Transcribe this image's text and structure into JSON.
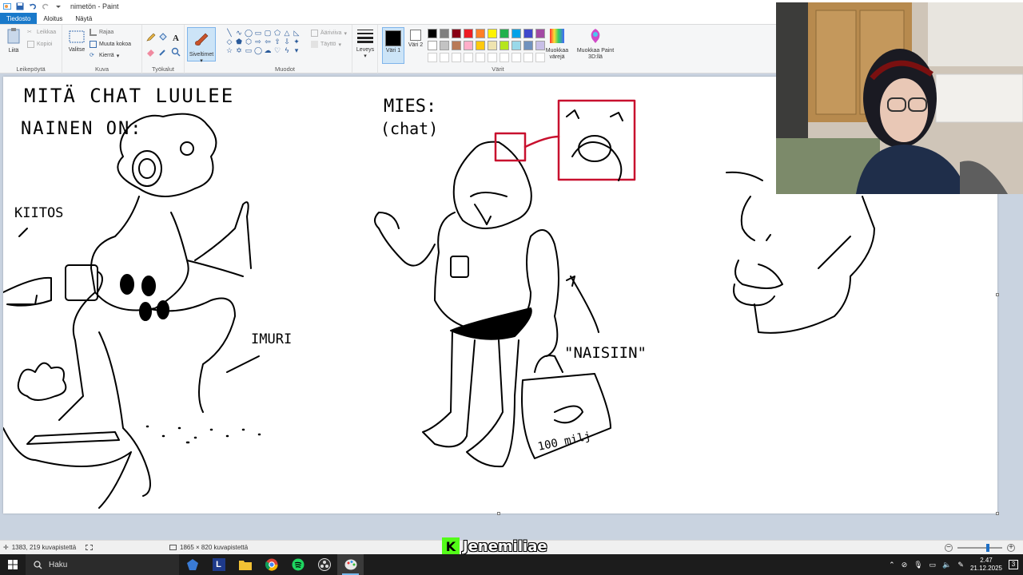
{
  "window": {
    "title": "nimetön - Paint",
    "quick_access_icons": [
      "save-icon",
      "undo-icon",
      "redo-icon",
      "customize-icon"
    ]
  },
  "tabs": [
    "Tiedosto",
    "Aloitus",
    "Näytä"
  ],
  "ribbon": {
    "clipboard": {
      "paste": "Liitä",
      "cut": "Leikkaa",
      "copy": "Kopioi",
      "label": "Leikepöytä"
    },
    "image": {
      "select": "Valitse",
      "crop": "Rajaa",
      "resize": "Muuta kokoa",
      "rotate": "Kierrä",
      "label": "Kuva"
    },
    "tools": {
      "label": "Työkalut"
    },
    "brushes": {
      "label": "Siveltimet"
    },
    "shapes": {
      "outline": "Ääriviiva",
      "fill": "Täyttö",
      "label": "Muodot"
    },
    "size": {
      "label": "Leveys"
    },
    "colors": {
      "color1": "Väri 1",
      "color2": "Väri 2",
      "edit": "Muokkaa värejä",
      "paint3d": "Muokkaa Paint 3D:llä",
      "label": "Värit",
      "color1_value": "#000000",
      "color2_value": "#ffffff",
      "palette_row1": [
        "#000000",
        "#7f7f7f",
        "#880015",
        "#ed1c24",
        "#ff7f27",
        "#fff200",
        "#22b14c",
        "#00a2e8",
        "#3f48cc",
        "#a349a4"
      ],
      "palette_row2": [
        "#ffffff",
        "#c3c3c3",
        "#b97a57",
        "#ffaec9",
        "#ffc90e",
        "#efe4b0",
        "#b5e61d",
        "#99d9ea",
        "#7092be",
        "#c8bfe7"
      ]
    }
  },
  "canvas": {
    "drawing_texts": [
      "MITÄ CHAT LUULEE",
      "NAINEN ON:",
      "KIITOS",
      "IMURI",
      "MIES:",
      "(chat)",
      "\"NAISIIN\"",
      "100 milj"
    ]
  },
  "statusbar": {
    "cursor": "1383, 219 kuvapistettä",
    "size": "1865 × 820 kuvapistettä"
  },
  "overlay": {
    "streamer": "Jenemiliae"
  },
  "taskbar": {
    "search": "Haku",
    "time": "2.47",
    "date": "21.12.2025"
  }
}
